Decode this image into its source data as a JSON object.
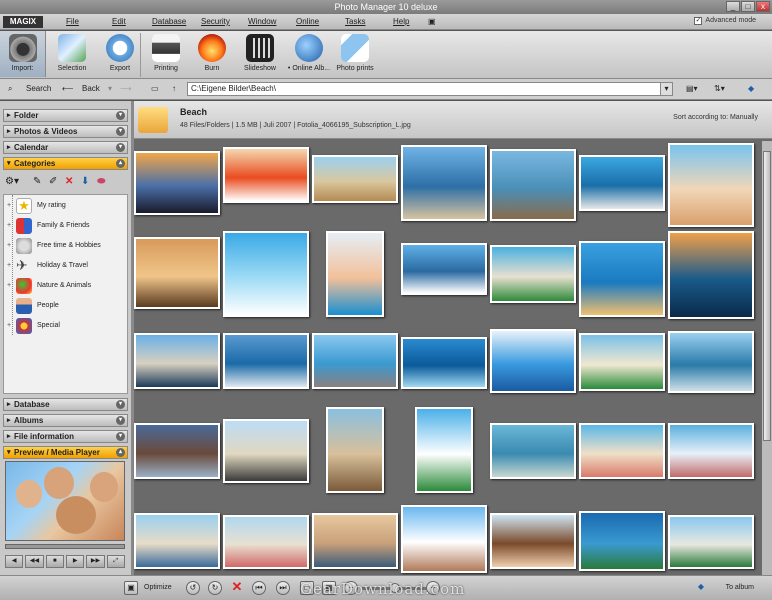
{
  "window": {
    "title": "Photo Manager 10 deluxe",
    "min": "_",
    "max": "□",
    "close": "x"
  },
  "menubar": {
    "logo": "MAGIX",
    "items": [
      "File",
      "Edit",
      "Database",
      "Security",
      "Window",
      "Online",
      "Tasks",
      "Help"
    ],
    "advanced_mode": "Advanced mode"
  },
  "toolbar": {
    "buttons": [
      "Import:",
      "Selection",
      "Export",
      "Printing",
      "Burn",
      "Slideshow",
      "• Online Alb...",
      "Photo prints"
    ]
  },
  "addressbar": {
    "search": "Search",
    "back": "Back",
    "path": "C:\\Eigene Bilder\\Beach\\"
  },
  "sidebar": {
    "panels_top": [
      "Folder",
      "Photos & Videos",
      "Calendar"
    ],
    "categories_title": "Categories",
    "categories": [
      "My rating",
      "Family & Friends",
      "Free time & Hobbies",
      "Holiday & Travel",
      "Nature & Animals",
      "People",
      "Special"
    ],
    "panels_bottom": [
      "Database",
      "Albums",
      "File information"
    ],
    "preview_title": "Preview / Media Player"
  },
  "folder": {
    "name": "Beach",
    "meta": "48 Files/Folders | 1.5 MB | Juli 2007 | Fotolia_4066195_Subscription_L.jpg",
    "sort": "Sort according to: Manually"
  },
  "statusbar": {
    "optimize": "Optimize",
    "to_album": "To album",
    "watermark": "GearDownload.com"
  },
  "colors": {
    "accent": "#f0a000",
    "panel_bg": "#c9c9c9",
    "grid_bg": "#6a6a6a",
    "delete": "#dd2222"
  }
}
